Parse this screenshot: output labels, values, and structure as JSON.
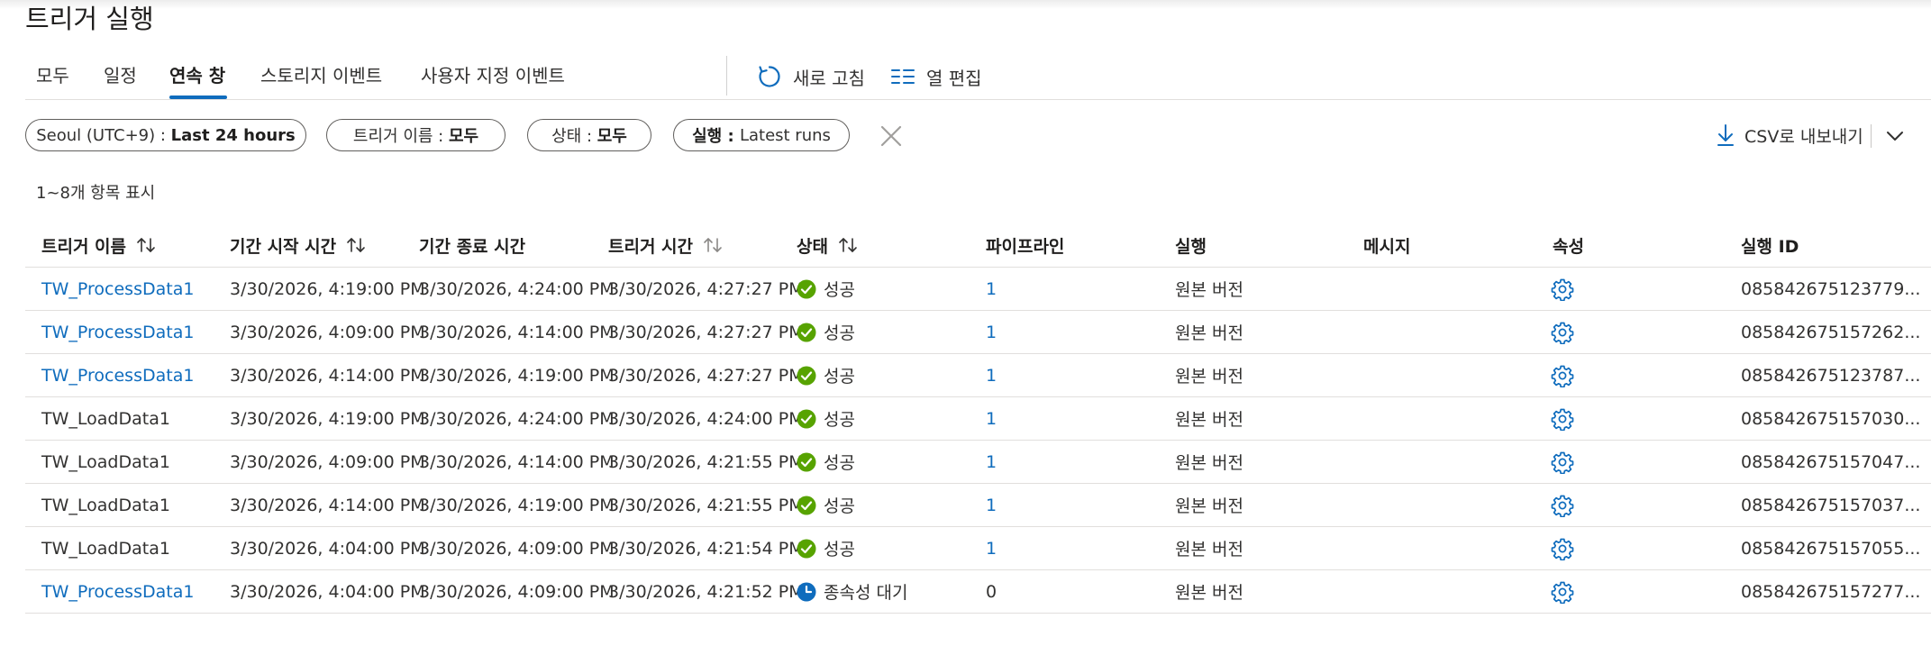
{
  "page": {
    "title": "트리거 실행"
  },
  "tabs": [
    {
      "label": "모두",
      "active": false
    },
    {
      "label": "일정",
      "active": false
    },
    {
      "label": "연속 창",
      "active": true
    },
    {
      "label": "스토리지 이벤트",
      "active": false
    },
    {
      "label": "사용자 지정 이벤트",
      "active": false
    }
  ],
  "toolbar": {
    "refresh_label": "새로 고침",
    "edit_columns_label": "열 편집"
  },
  "filters": {
    "time": {
      "prefix": "Seoul (UTC+9) : ",
      "value": "Last 24 hours"
    },
    "trigger_name": {
      "prefix": "트리거 이름 : ",
      "value": "모두"
    },
    "status": {
      "prefix": "상태 : ",
      "value": "모두"
    },
    "run": {
      "prefix": "실행 : ",
      "value": "Latest runs"
    }
  },
  "export": {
    "label": "CSV로 내보내기"
  },
  "count_text": "1~8개 항목 표시",
  "columns": [
    "트리거 이름",
    "기간 시작 시간",
    "기간 종료 시간",
    "트리거 시간",
    "상태",
    "파이프라인",
    "실행",
    "메시지",
    "속성",
    "실행 ID"
  ],
  "colors": {
    "link": "#0f6cbd",
    "success": "#57a300",
    "waiting": "#0f6cbd",
    "accent": "#0f6cbd"
  },
  "rows": [
    {
      "name": "TW_ProcessData1",
      "name_link": true,
      "start": "3/30/2026, 4:19:00 PM",
      "end": "3/30/2026, 4:24:00 PM",
      "trigger_time": "3/30/2026, 4:27:27 PM",
      "status": "성공",
      "status_type": "success",
      "pipeline": "1",
      "pipeline_link": true,
      "run": "원본 버전",
      "message": "",
      "run_id": "085842675123779..."
    },
    {
      "name": "TW_ProcessData1",
      "name_link": true,
      "start": "3/30/2026, 4:09:00 PM",
      "end": "3/30/2026, 4:14:00 PM",
      "trigger_time": "3/30/2026, 4:27:27 PM",
      "status": "성공",
      "status_type": "success",
      "pipeline": "1",
      "pipeline_link": true,
      "run": "원본 버전",
      "message": "",
      "run_id": "085842675157262..."
    },
    {
      "name": "TW_ProcessData1",
      "name_link": true,
      "start": "3/30/2026, 4:14:00 PM",
      "end": "3/30/2026, 4:19:00 PM",
      "trigger_time": "3/30/2026, 4:27:27 PM",
      "status": "성공",
      "status_type": "success",
      "pipeline": "1",
      "pipeline_link": true,
      "run": "원본 버전",
      "message": "",
      "run_id": "085842675123787..."
    },
    {
      "name": "TW_LoadData1",
      "name_link": false,
      "start": "3/30/2026, 4:19:00 PM",
      "end": "3/30/2026, 4:24:00 PM",
      "trigger_time": "3/30/2026, 4:24:00 PM",
      "status": "성공",
      "status_type": "success",
      "pipeline": "1",
      "pipeline_link": true,
      "run": "원본 버전",
      "message": "",
      "run_id": "085842675157030..."
    },
    {
      "name": "TW_LoadData1",
      "name_link": false,
      "start": "3/30/2026, 4:09:00 PM",
      "end": "3/30/2026, 4:14:00 PM",
      "trigger_time": "3/30/2026, 4:21:55 PM",
      "status": "성공",
      "status_type": "success",
      "pipeline": "1",
      "pipeline_link": true,
      "run": "원본 버전",
      "message": "",
      "run_id": "085842675157047..."
    },
    {
      "name": "TW_LoadData1",
      "name_link": false,
      "start": "3/30/2026, 4:14:00 PM",
      "end": "3/30/2026, 4:19:00 PM",
      "trigger_time": "3/30/2026, 4:21:55 PM",
      "status": "성공",
      "status_type": "success",
      "pipeline": "1",
      "pipeline_link": true,
      "run": "원본 버전",
      "message": "",
      "run_id": "085842675157037..."
    },
    {
      "name": "TW_LoadData1",
      "name_link": false,
      "start": "3/30/2026, 4:04:00 PM",
      "end": "3/30/2026, 4:09:00 PM",
      "trigger_time": "3/30/2026, 4:21:54 PM",
      "status": "성공",
      "status_type": "success",
      "pipeline": "1",
      "pipeline_link": true,
      "run": "원본 버전",
      "message": "",
      "run_id": "085842675157055..."
    },
    {
      "name": "TW_ProcessData1",
      "name_link": true,
      "start": "3/30/2026, 4:04:00 PM",
      "end": "3/30/2026, 4:09:00 PM",
      "trigger_time": "3/30/2026, 4:21:52 PM",
      "status": "종속성 대기",
      "status_type": "waiting",
      "pipeline": "0",
      "pipeline_link": false,
      "run": "원본 버전",
      "message": "",
      "run_id": "085842675157277..."
    }
  ]
}
